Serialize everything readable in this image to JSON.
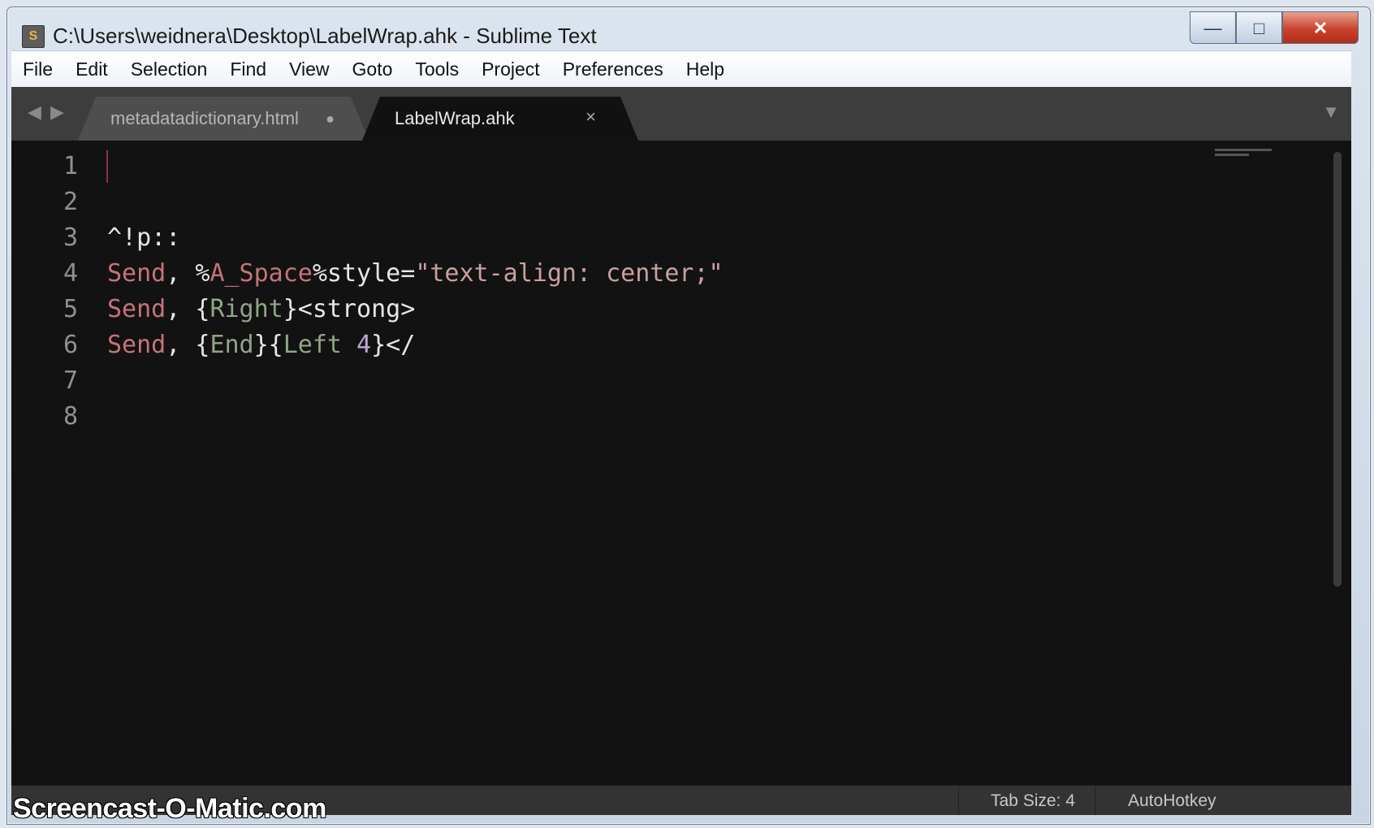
{
  "window": {
    "title": "C:\\Users\\weidnera\\Desktop\\LabelWrap.ahk - Sublime Text",
    "controls": {
      "minimize": "—",
      "maximize": "□",
      "close": "✕"
    }
  },
  "menu": [
    "File",
    "Edit",
    "Selection",
    "Find",
    "View",
    "Goto",
    "Tools",
    "Project",
    "Preferences",
    "Help"
  ],
  "tabs": [
    {
      "label": "metadatadictionary.html",
      "modified": true,
      "active": false
    },
    {
      "label": "LabelWrap.ahk",
      "modified": false,
      "active": true
    }
  ],
  "tab_glyphs": {
    "modified_dot": "●",
    "close": "×",
    "dropdown": "▼",
    "nav_left": "◀",
    "nav_right": "▶"
  },
  "editor": {
    "line_numbers": [
      "1",
      "2",
      "3",
      "4",
      "5",
      "6",
      "7",
      "8"
    ],
    "lines": [
      [],
      [],
      [
        {
          "t": "^!p::",
          "c": ""
        }
      ],
      [
        {
          "t": "Send",
          "c": "kw"
        },
        {
          "t": ", %",
          "c": ""
        },
        {
          "t": "A_Space",
          "c": "var"
        },
        {
          "t": "%style=",
          "c": ""
        },
        {
          "t": "\"text-align: center;\"",
          "c": "str"
        }
      ],
      [
        {
          "t": "Send",
          "c": "kw"
        },
        {
          "t": ", {",
          "c": ""
        },
        {
          "t": "Right",
          "c": "key"
        },
        {
          "t": "}<strong>",
          "c": ""
        }
      ],
      [
        {
          "t": "Send",
          "c": "kw"
        },
        {
          "t": ", {",
          "c": ""
        },
        {
          "t": "End",
          "c": "key"
        },
        {
          "t": "}{",
          "c": ""
        },
        {
          "t": "Left",
          "c": "key"
        },
        {
          "t": " 4",
          "c": "num"
        },
        {
          "t": "}</",
          "c": ""
        }
      ],
      [],
      []
    ]
  },
  "status": {
    "tab_size": "Tab Size: 4",
    "syntax": "AutoHotkey"
  },
  "watermark": "Screencast-O-Matic.com",
  "colors": {
    "editor_bg": "#121212",
    "keyword": "#c4737a",
    "string": "#c9a0a0",
    "key_name": "#8fa584",
    "number": "#b9a7d6",
    "cursor": "#8b2f5f"
  }
}
